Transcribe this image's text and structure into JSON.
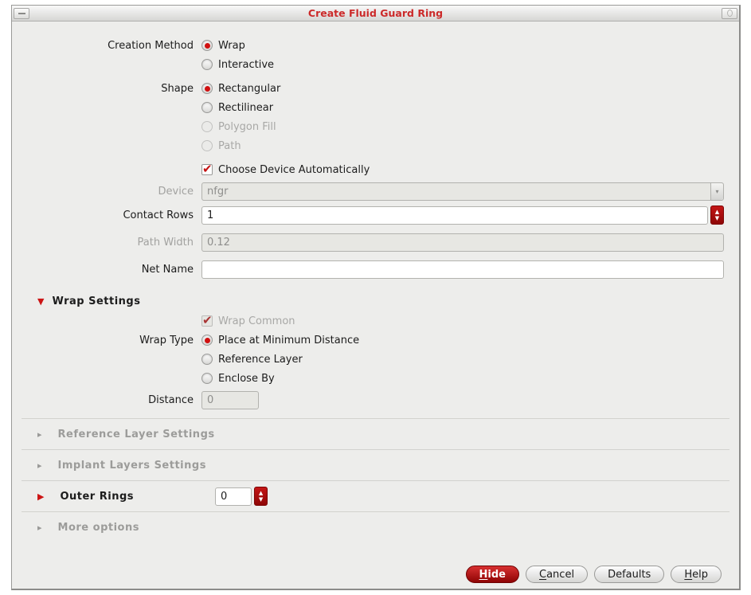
{
  "window": {
    "title": "Create Fluid Guard Ring"
  },
  "icons": {
    "titlebar_left": "window-menu-icon (dash glyph)",
    "titlebar_right": "window-corner-icon (small circle glyph)",
    "dropdown_arrow": "chevron-down-icon",
    "spinner_up": "triangle-up-icon",
    "spinner_down": "triangle-down-icon",
    "section_collapsed": "triangle-right-icon",
    "section_expanded": "triangle-down-icon"
  },
  "colors": {
    "accent_red": "#b00f0f",
    "title_red": "#cc2a2a",
    "dialog_bg": "#ededeb",
    "disabled_text": "#a0a09e"
  },
  "form": {
    "creation_method": {
      "label": "Creation Method",
      "options": [
        {
          "label": "Wrap",
          "selected": true
        },
        {
          "label": "Interactive",
          "selected": false
        }
      ]
    },
    "shape": {
      "label": "Shape",
      "options": [
        {
          "label": "Rectangular",
          "selected": true
        },
        {
          "label": "Rectilinear",
          "selected": false
        },
        {
          "label": "Polygon Fill",
          "selected": false,
          "disabled": true
        },
        {
          "label": "Path",
          "selected": false,
          "disabled": true
        }
      ]
    },
    "choose_device": {
      "label": "Choose Device Automatically",
      "checked": true
    },
    "device": {
      "label": "Device",
      "value": "nfgr",
      "disabled": true
    },
    "contact_rows": {
      "label": "Contact Rows",
      "value": "1"
    },
    "path_width": {
      "label": "Path Width",
      "value": "0.12",
      "disabled": true
    },
    "net_name": {
      "label": "Net Name",
      "value": ""
    },
    "wrap_settings": {
      "title": "Wrap Settings",
      "expanded": true,
      "wrap_common": {
        "label": "Wrap Common",
        "checked": true,
        "disabled": true
      },
      "wrap_type": {
        "label": "Wrap Type",
        "options": [
          {
            "label": "Place at Minimum Distance",
            "selected": true
          },
          {
            "label": "Reference Layer",
            "selected": false
          },
          {
            "label": "Enclose By",
            "selected": false
          }
        ]
      },
      "distance": {
        "label": "Distance",
        "value": "0",
        "disabled": true
      }
    },
    "sections": [
      {
        "title": "Reference Layer Settings",
        "disabled": true,
        "expanded": false
      },
      {
        "title": "Implant Layers Settings",
        "disabled": true,
        "expanded": false
      },
      {
        "title": "Outer Rings",
        "disabled": false,
        "expanded": false,
        "value": "0"
      },
      {
        "title": "More options",
        "disabled": true,
        "expanded": false
      }
    ]
  },
  "buttons": [
    {
      "label": "Hide",
      "accel": "H",
      "primary": true
    },
    {
      "label": "Cancel",
      "accel": "C",
      "primary": false
    },
    {
      "label": "Defaults",
      "accel": null,
      "primary": false
    },
    {
      "label": "Help",
      "accel": "H",
      "primary": false
    }
  ]
}
